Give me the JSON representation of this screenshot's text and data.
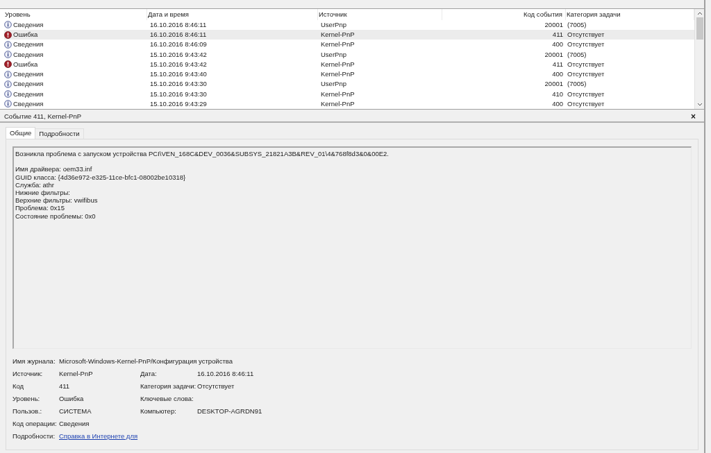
{
  "events_table": {
    "columns": [
      "Уровень",
      "Дата и время",
      "Источник",
      "Код события",
      "Категория задачи"
    ],
    "rows": [
      {
        "kind": "info",
        "level": "Сведения",
        "date": "16.10.2016 8:46:11",
        "source": "UserPnp",
        "code": "20001",
        "category": "(7005)",
        "selected": false
      },
      {
        "kind": "error",
        "level": "Ошибка",
        "date": "16.10.2016 8:46:11",
        "source": "Kernel-PnP",
        "code": "411",
        "category": "Отсутствует",
        "selected": true
      },
      {
        "kind": "info",
        "level": "Сведения",
        "date": "16.10.2016 8:46:09",
        "source": "Kernel-PnP",
        "code": "400",
        "category": "Отсутствует",
        "selected": false
      },
      {
        "kind": "info",
        "level": "Сведения",
        "date": "15.10.2016 9:43:42",
        "source": "UserPnp",
        "code": "20001",
        "category": "(7005)",
        "selected": false
      },
      {
        "kind": "error",
        "level": "Ошибка",
        "date": "15.10.2016 9:43:42",
        "source": "Kernel-PnP",
        "code": "411",
        "category": "Отсутствует",
        "selected": false
      },
      {
        "kind": "info",
        "level": "Сведения",
        "date": "15.10.2016 9:43:40",
        "source": "Kernel-PnP",
        "code": "400",
        "category": "Отсутствует",
        "selected": false
      },
      {
        "kind": "info",
        "level": "Сведения",
        "date": "15.10.2016 9:43:30",
        "source": "UserPnp",
        "code": "20001",
        "category": "(7005)",
        "selected": false
      },
      {
        "kind": "info",
        "level": "Сведения",
        "date": "15.10.2016 9:43:30",
        "source": "Kernel-PnP",
        "code": "410",
        "category": "Отсутствует",
        "selected": false
      },
      {
        "kind": "info",
        "level": "Сведения",
        "date": "15.10.2016 9:43:29",
        "source": "Kernel-PnP",
        "code": "400",
        "category": "Отсутствует",
        "selected": false
      }
    ]
  },
  "detail": {
    "title": "Событие 411, Kernel-PnP",
    "close": "×",
    "tabs": [
      {
        "label": "Общие",
        "selected": true
      },
      {
        "label": "Подробности",
        "selected": false
      }
    ],
    "description": [
      [
        "Возникла проблема с запуском устройства PCI\\VEN_168C&DEV_0036&SUBSYS_21821A3B&REV_01\\4&768f8d3&0&00E2."
      ],
      [
        "Имя драйвера: oem33.inf",
        "GUID класса: {4d36e972-e325-11ce-bfc1-08002be10318}",
        "Служба: athr",
        "Нижние фильтры:",
        "Верхние фильтры: vwifibus",
        "Проблема: 0x15",
        "Состояние проблемы: 0x0"
      ]
    ],
    "log_name": {
      "label": "Имя журнала:",
      "value": "Microsoft-Windows-Kernel-PnP/Конфигурация устройства"
    },
    "fields": [
      [
        {
          "label": "Источник:",
          "value": "Kernel-PnP"
        },
        {
          "label": "Дата:",
          "value": "16.10.2016 8:46:11"
        }
      ],
      [
        {
          "label": "Код",
          "value": "411"
        },
        {
          "label": "Категория задачи:",
          "value": "Отсутствует"
        }
      ],
      [
        {
          "label": "Уровень:",
          "value": "Ошибка"
        },
        {
          "label": "Ключевые слова:"
        }
      ],
      [
        {
          "label": "Пользов.:",
          "value": "СИСТЕМА"
        },
        {
          "label": "Компьютер:",
          "value": "DESKTOP-AGRDN91"
        }
      ],
      [
        {
          "label": "Код операции:",
          "value": "Сведения"
        }
      ],
      [
        {
          "label": "Подробности:",
          "link": "Справка в Интернете для"
        }
      ]
    ]
  }
}
